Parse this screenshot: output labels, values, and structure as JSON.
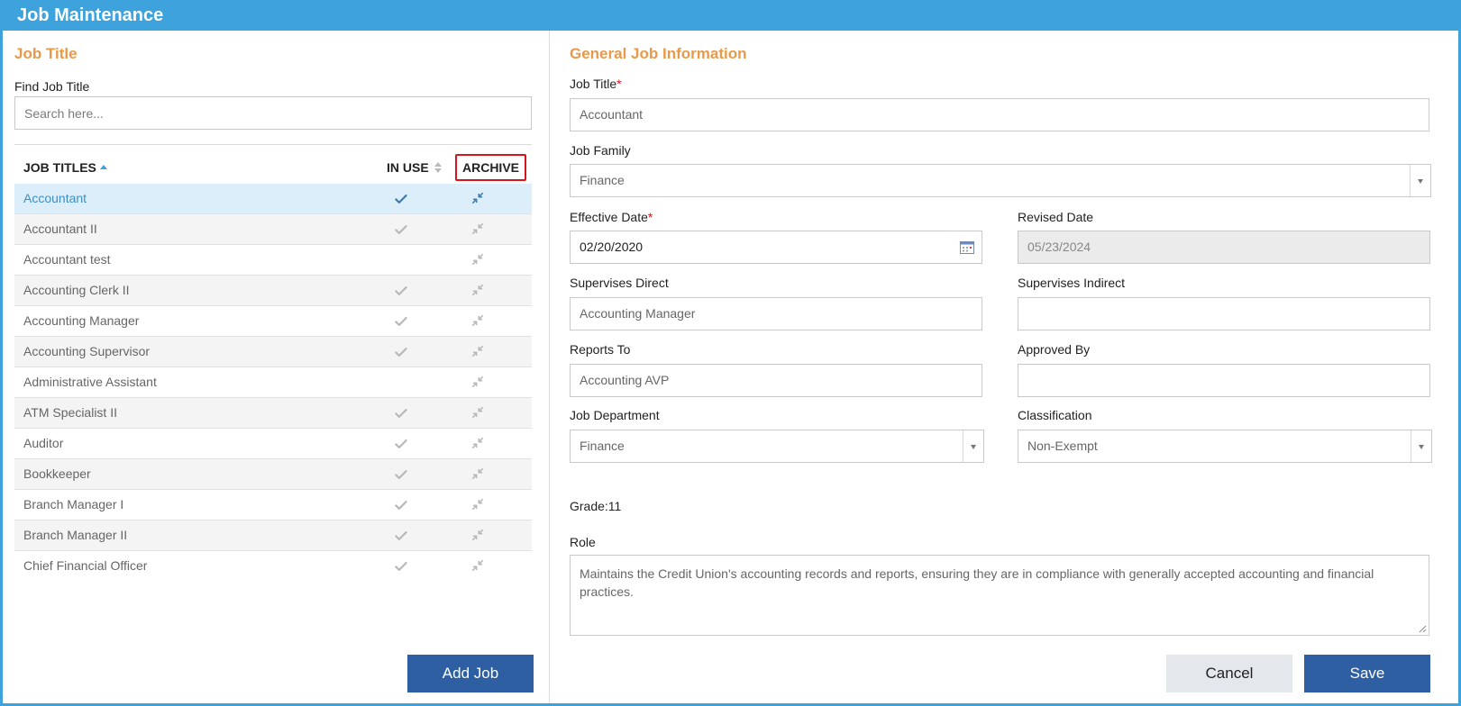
{
  "window": {
    "title": "Job Maintenance"
  },
  "left": {
    "section_title": "Job Title",
    "find_label": "Find Job Title",
    "search_placeholder": "Search here...",
    "columns": {
      "title": "JOB TITLES",
      "in_use": "IN USE",
      "archive": "ARCHIVE"
    },
    "rows": [
      {
        "name": "Accountant",
        "in_use": true,
        "selected": true
      },
      {
        "name": "Accountant II",
        "in_use": true,
        "selected": false
      },
      {
        "name": "Accountant test",
        "in_use": false,
        "selected": false
      },
      {
        "name": "Accounting Clerk II",
        "in_use": true,
        "selected": false
      },
      {
        "name": "Accounting Manager",
        "in_use": true,
        "selected": false
      },
      {
        "name": "Accounting Supervisor",
        "in_use": true,
        "selected": false
      },
      {
        "name": "Administrative Assistant",
        "in_use": false,
        "selected": false
      },
      {
        "name": "ATM Specialist II",
        "in_use": true,
        "selected": false
      },
      {
        "name": "Auditor",
        "in_use": true,
        "selected": false
      },
      {
        "name": "Bookkeeper",
        "in_use": true,
        "selected": false
      },
      {
        "name": "Branch Manager I",
        "in_use": true,
        "selected": false
      },
      {
        "name": "Branch Manager II",
        "in_use": true,
        "selected": false
      },
      {
        "name": "Chief Financial Officer",
        "in_use": true,
        "selected": false
      }
    ],
    "add_job_label": "Add Job"
  },
  "right": {
    "section_title": "General Job Information",
    "job_title": {
      "label": "Job Title",
      "required": "*",
      "value": "Accountant"
    },
    "job_family": {
      "label": "Job Family",
      "value": "Finance"
    },
    "effective_date": {
      "label": "Effective Date",
      "required": "*",
      "value": "02/20/2020"
    },
    "revised_date": {
      "label": "Revised Date",
      "value": "05/23/2024"
    },
    "supervises_direct": {
      "label": "Supervises Direct",
      "value": "Accounting Manager"
    },
    "supervises_indirect": {
      "label": "Supervises Indirect",
      "value": ""
    },
    "reports_to": {
      "label": "Reports To",
      "value": "Accounting AVP"
    },
    "approved_by": {
      "label": "Approved By",
      "value": ""
    },
    "job_department": {
      "label": "Job Department",
      "value": "Finance"
    },
    "classification": {
      "label": "Classification",
      "value": "Non-Exempt"
    },
    "grade": "Grade:11",
    "role": {
      "label": "Role",
      "value": "Maintains the Credit Union's accounting records and reports, ensuring they are in compliance with generally accepted accounting and financial practices."
    },
    "cancel_label": "Cancel",
    "save_label": "Save"
  },
  "colors": {
    "titlebar": "#3ea2dc",
    "section_title": "#e8994a",
    "primary_button": "#2d5fa2",
    "selected_row": "#dbeef9",
    "highlight_border": "#d9141c"
  },
  "icons": {
    "in_use": "check-icon",
    "archive": "archive-arrows-icon",
    "calendar": "calendar-icon",
    "dropdown": "chevron-down-icon"
  }
}
